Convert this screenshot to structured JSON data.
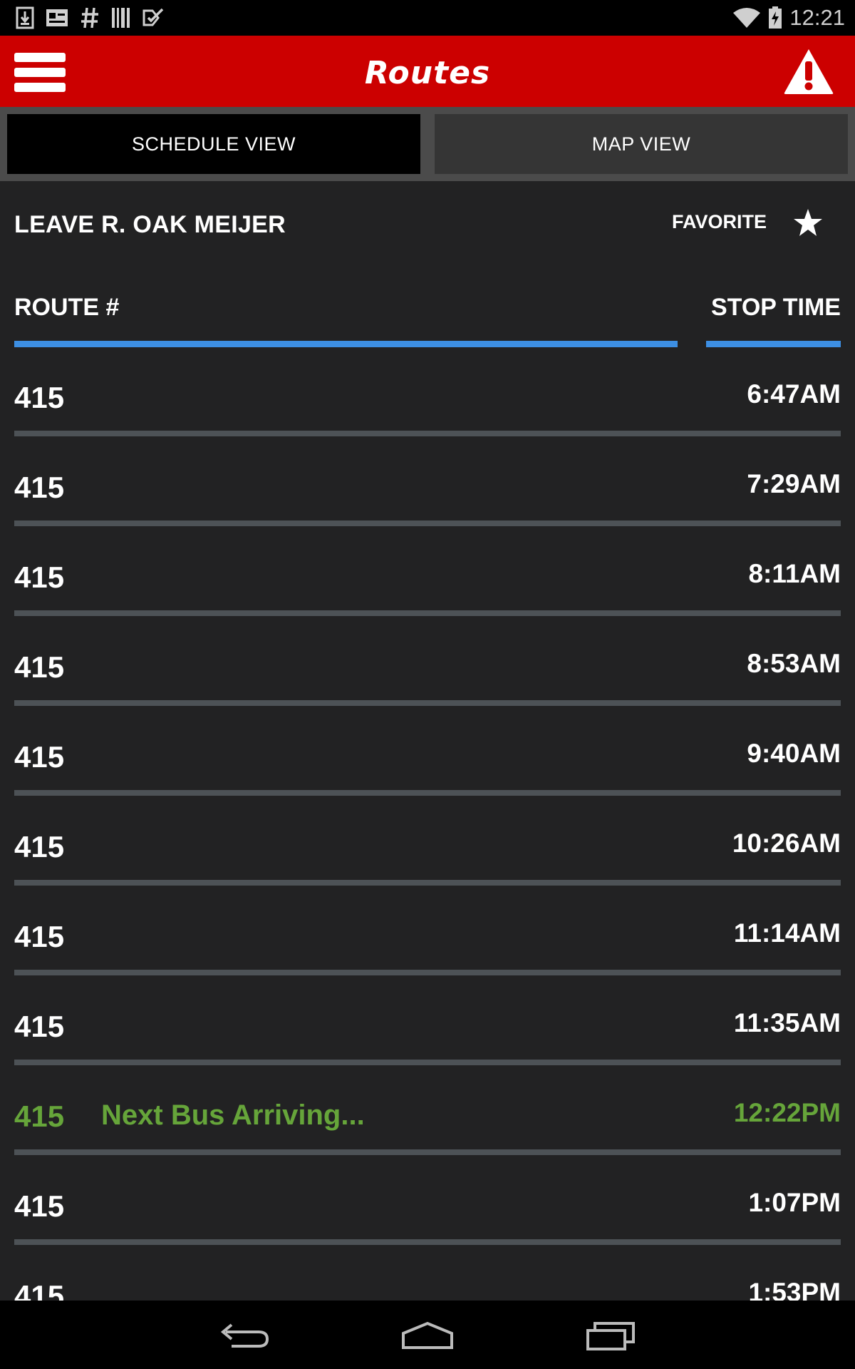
{
  "status_bar": {
    "time": "12:21",
    "notification_icons": [
      "download-icon",
      "news-icon",
      "hashtag-icon",
      "barcode-icon",
      "checklist-icon"
    ],
    "wifi_icon": "wifi-icon",
    "battery_icon": "battery-charging-icon"
  },
  "app_bar": {
    "title": "Routes",
    "menu_icon": "hamburger-menu-icon",
    "alert_icon": "warning-icon",
    "background_color": "#cc0000"
  },
  "tabs": [
    {
      "label": "SCHEDULE VIEW",
      "active": true
    },
    {
      "label": "MAP VIEW",
      "active": false
    }
  ],
  "stop": {
    "title": "LEAVE R. OAK MEIJER",
    "favorite_label": "FAVORITE",
    "favorite_icon": "star-icon"
  },
  "columns": {
    "route": "ROUTE #",
    "time": "STOP TIME",
    "accent_color": "#3d8fe3"
  },
  "schedule": [
    {
      "route": "415",
      "note": "",
      "time": "6:47AM"
    },
    {
      "route": "415",
      "note": "",
      "time": "7:29AM"
    },
    {
      "route": "415",
      "note": "",
      "time": "8:11AM"
    },
    {
      "route": "415",
      "note": "",
      "time": "8:53AM"
    },
    {
      "route": "415",
      "note": "",
      "time": "9:40AM"
    },
    {
      "route": "415",
      "note": "",
      "time": "10:26AM"
    },
    {
      "route": "415",
      "note": "",
      "time": "11:14AM"
    },
    {
      "route": "415",
      "note": "",
      "time": "11:35AM"
    },
    {
      "route": "415",
      "note": "Next Bus Arriving...",
      "time": "12:22PM",
      "next": true
    },
    {
      "route": "415",
      "note": "",
      "time": "1:07PM"
    },
    {
      "route": "415",
      "note": "",
      "time": "1:53PM"
    }
  ],
  "next_bus_color": "#66a53a",
  "nav_bar": {
    "back_icon": "back-icon",
    "home_icon": "home-icon",
    "recents_icon": "recent-apps-icon"
  }
}
